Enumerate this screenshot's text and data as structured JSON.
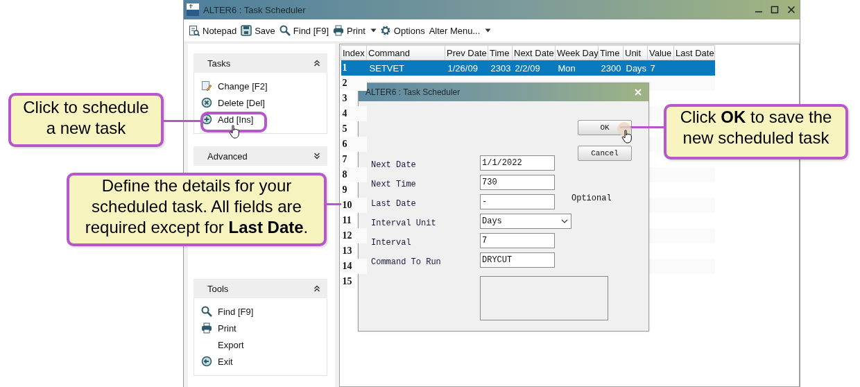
{
  "window": {
    "title": "ALTER6 : Task Scheduler"
  },
  "toolbar": [
    {
      "kind": "notepad",
      "label": "Notepad"
    },
    {
      "kind": "save",
      "label": "Save"
    },
    {
      "kind": "find",
      "label": "Find [F9]"
    },
    {
      "kind": "print",
      "label": "Print",
      "dropdown": true
    },
    {
      "kind": "options",
      "label": "Options"
    },
    {
      "kind": "menu",
      "label": "Alter Menu...",
      "dropdown": true
    }
  ],
  "sidebar": {
    "sections": [
      {
        "title": "Tasks",
        "expanded": true,
        "items": [
          {
            "kind": "change",
            "label": "Change [F2]"
          },
          {
            "kind": "delete",
            "label": "Delete [Del]"
          },
          {
            "kind": "add",
            "label": "Add [Ins]"
          }
        ]
      },
      {
        "title": "Advanced",
        "expanded": false
      },
      {
        "title": "Tools",
        "expanded": true,
        "items": [
          {
            "kind": "find",
            "label": "Find [F9]"
          },
          {
            "kind": "print",
            "label": "Print"
          },
          {
            "kind": "export",
            "label": "Export"
          },
          {
            "kind": "exit",
            "label": "Exit"
          }
        ]
      }
    ]
  },
  "table": {
    "columns": [
      "Index",
      "Command",
      "Prev Date",
      "Time",
      "Next Date",
      "Week Day",
      "Time",
      "Unit",
      "Value",
      "Last Date"
    ],
    "rows": [
      {
        "index": "1",
        "selected": true,
        "cells": [
          "SETVET",
          "1/26/09",
          "2303",
          "2/2/09",
          "Mon",
          "2300",
          "Days",
          "7"
        ]
      },
      {
        "index": "2",
        "selected": false
      },
      {
        "index": "3",
        "selected": false
      },
      {
        "index": "4",
        "selected": false
      },
      {
        "index": "5",
        "selected": false
      },
      {
        "index": "6",
        "selected": false
      },
      {
        "index": "7",
        "selected": false
      },
      {
        "index": "8",
        "selected": false
      },
      {
        "index": "9",
        "selected": false
      },
      {
        "index": "10",
        "selected": false
      },
      {
        "index": "11",
        "selected": false
      },
      {
        "index": "12",
        "selected": false
      },
      {
        "index": "13",
        "selected": false
      },
      {
        "index": "14",
        "selected": false
      },
      {
        "index": "15",
        "selected": false
      }
    ]
  },
  "dialog": {
    "title": "ALTER6 : Task Scheduler",
    "buttons": [
      "OK",
      "Cancel"
    ],
    "fields": [
      {
        "kind": "text",
        "label": "Next Date",
        "value": "1/1/2022"
      },
      {
        "kind": "text",
        "label": "Next Time",
        "value": "730"
      },
      {
        "kind": "text",
        "label": "Last Date",
        "value": "-",
        "note": "Optional"
      },
      {
        "kind": "select",
        "label": "Interval Unit",
        "value": "Days"
      },
      {
        "kind": "text",
        "label": "Interval",
        "value": "7"
      },
      {
        "kind": "text",
        "label": "Command To Run",
        "value": "DRYCUT"
      },
      {
        "kind": "memo",
        "disabled": true
      }
    ]
  },
  "callouts": [
    {
      "text": "Click to schedule a new task"
    },
    {
      "text": "Define the details for your scheduled task. All fields are required except for **Last Date**."
    },
    {
      "text": "Click **OK** to save the new scheduled task"
    }
  ]
}
